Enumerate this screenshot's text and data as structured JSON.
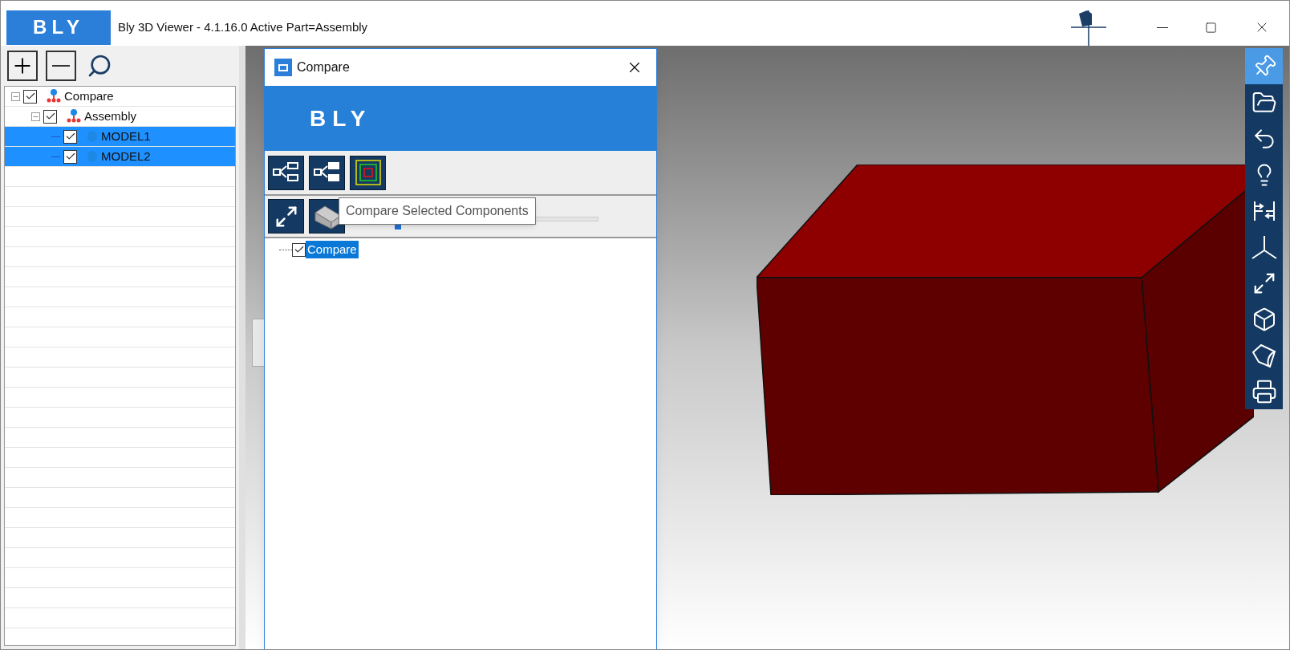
{
  "window": {
    "logo": "BLY",
    "title": "Bly 3D Viewer - 4.1.16.0 Active Part=Assembly"
  },
  "tree": [
    {
      "label": "Compare",
      "kind": "assembly",
      "checked": true,
      "expanded": true,
      "selected": false,
      "children": [
        {
          "label": "Assembly",
          "kind": "assembly",
          "checked": true,
          "expanded": true,
          "selected": false,
          "children": [
            {
              "label": "MODEL1",
              "kind": "part",
              "checked": true,
              "selected": true
            },
            {
              "label": "MODEL2",
              "kind": "part",
              "checked": true,
              "selected": true
            }
          ]
        }
      ]
    }
  ],
  "dialog": {
    "title": "Compare",
    "banner_logo": "BLY",
    "tooltip": "Compare Selected Components",
    "slider": {
      "level": 0.12
    },
    "tree": [
      {
        "label": "Compare",
        "checked": true,
        "selected": true
      }
    ]
  },
  "right_toolbar": [
    {
      "kind": "pin",
      "selected": true
    },
    {
      "kind": "folder",
      "selected": false
    },
    {
      "kind": "undo",
      "selected": false
    },
    {
      "kind": "bulb",
      "selected": false
    },
    {
      "kind": "compare",
      "selected": false
    },
    {
      "kind": "axes",
      "selected": false
    },
    {
      "kind": "fit",
      "selected": false
    },
    {
      "kind": "box",
      "selected": false
    },
    {
      "kind": "light",
      "selected": false
    },
    {
      "kind": "print",
      "selected": false
    }
  ]
}
